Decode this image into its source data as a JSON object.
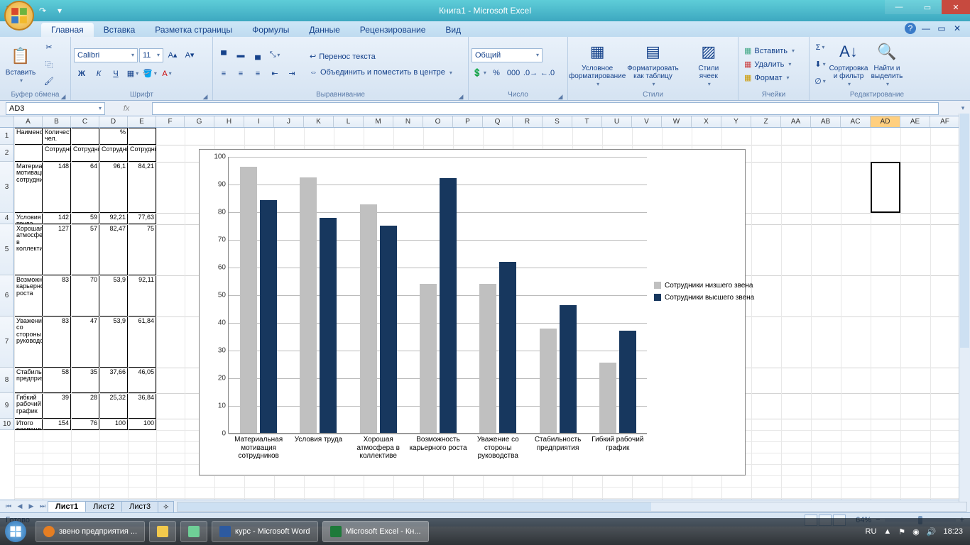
{
  "app": {
    "title": "Книга1 - Microsoft Excel"
  },
  "tabs": {
    "t0": "Главная",
    "t1": "Вставка",
    "t2": "Разметка страницы",
    "t3": "Формулы",
    "t4": "Данные",
    "t5": "Рецензирование",
    "t6": "Вид"
  },
  "ribbon": {
    "clipboard": {
      "paste": "Вставить",
      "label": "Буфер обмена"
    },
    "font": {
      "name": "Calibri",
      "size": "11",
      "label": "Шрифт",
      "bold": "Ж",
      "italic": "К",
      "underline": "Ч"
    },
    "align": {
      "wrap": "Перенос текста",
      "merge": "Объединить и поместить в центре",
      "label": "Выравнивание"
    },
    "number": {
      "format": "Общий",
      "label": "Число"
    },
    "styles": {
      "cond": "Условное форматирование",
      "table": "Форматировать как таблицу",
      "cell": "Стили ячеек",
      "label": "Стили"
    },
    "cells": {
      "insert": "Вставить",
      "delete": "Удалить",
      "format": "Формат",
      "label": "Ячейки"
    },
    "editing": {
      "sort": "Сортировка и фильтр",
      "find": "Найти и выделить",
      "label": "Редактирование"
    }
  },
  "formula": {
    "cell": "AD3",
    "fx": "fx"
  },
  "columns": [
    "A",
    "B",
    "C",
    "D",
    "E",
    "F",
    "G",
    "H",
    "I",
    "J",
    "K",
    "L",
    "M",
    "N",
    "O",
    "P",
    "Q",
    "R",
    "S",
    "T",
    "U",
    "V",
    "W",
    "X",
    "Y",
    "Z",
    "AA",
    "AB",
    "AC",
    "AD",
    "AE",
    "AF"
  ],
  "table": {
    "h1a": "Наименование",
    "h1b": "Количество чел.",
    "h1c": "%",
    "h2": [
      "Сотрудники",
      "Сотрудники",
      "Сотрудники",
      "Сотрудники"
    ],
    "rows": [
      {
        "name": "Материальная мотивация сотрудников",
        "v": [
          "148",
          "64",
          "96,1",
          "84,21"
        ]
      },
      {
        "name": "Условия труда",
        "v": [
          "142",
          "59",
          "92,21",
          "77,63"
        ]
      },
      {
        "name": "Хорошая атмосфера в коллективе",
        "v": [
          "127",
          "57",
          "82,47",
          "75"
        ]
      },
      {
        "name": "Возможность карьерного роста",
        "v": [
          "83",
          "70",
          "53,9",
          "92,11"
        ]
      },
      {
        "name": "Уважение со стороны руководства",
        "v": [
          "83",
          "47",
          "53,9",
          "61,84"
        ]
      },
      {
        "name": "Стабильность предприятия",
        "v": [
          "58",
          "35",
          "37,66",
          "46,05"
        ]
      },
      {
        "name": "Гибкий рабочий график",
        "v": [
          "39",
          "28",
          "25,32",
          "36,84"
        ]
      },
      {
        "name": "Итого респонд",
        "v": [
          "154",
          "76",
          "100",
          "100"
        ]
      }
    ]
  },
  "chart_data": {
    "type": "bar",
    "categories": [
      "Материальная мотивация сотрудников",
      "Условия труда",
      "Хорошая атмосфера в коллективе",
      "Возможность карьерного роста",
      "Уважение со стороны руководства",
      "Стабильность предприятия",
      "Гибкий рабочий график"
    ],
    "series": [
      {
        "name": "Сотрудники низшего звена",
        "values": [
          96.1,
          92.21,
          82.47,
          53.9,
          53.9,
          37.66,
          25.32
        ],
        "color": "#c0c0c0"
      },
      {
        "name": "Сотрудники высшего звена",
        "values": [
          84.21,
          77.63,
          75,
          92.11,
          61.84,
          46.05,
          36.84
        ],
        "color": "#17375e"
      }
    ],
    "ylim": [
      0,
      100
    ],
    "yticks": [
      0,
      10,
      20,
      30,
      40,
      50,
      60,
      70,
      80,
      90,
      100
    ]
  },
  "sheets": {
    "s1": "Лист1",
    "s2": "Лист2",
    "s3": "Лист3"
  },
  "status": {
    "ready": "Готово",
    "zoom": "64%"
  },
  "taskbar": {
    "t1": "звено предприятия ...",
    "t2": "курс - Microsoft Word",
    "t3": "Microsoft Excel - Кн...",
    "clock": "18:23",
    "lang": "RU"
  }
}
